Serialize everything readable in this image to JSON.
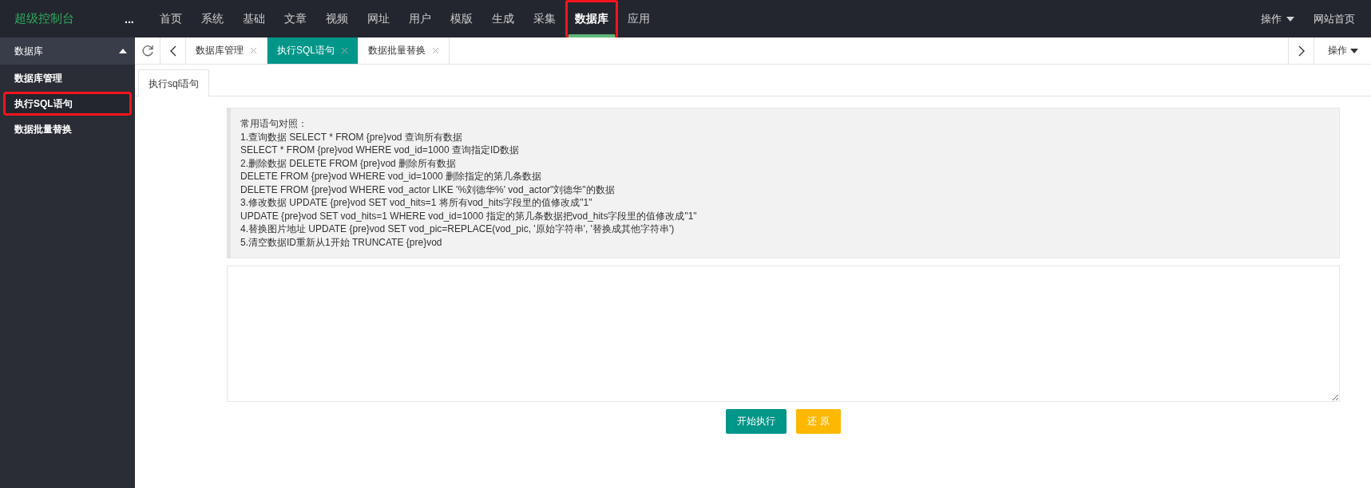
{
  "brand": "超级控制台",
  "nav_more": "...",
  "nav": [
    {
      "label": "首页",
      "selected": false,
      "highlighted": false
    },
    {
      "label": "系统",
      "selected": false,
      "highlighted": false
    },
    {
      "label": "基础",
      "selected": false,
      "highlighted": false
    },
    {
      "label": "文章",
      "selected": false,
      "highlighted": false
    },
    {
      "label": "视频",
      "selected": false,
      "highlighted": false
    },
    {
      "label": "网址",
      "selected": false,
      "highlighted": false
    },
    {
      "label": "用户",
      "selected": false,
      "highlighted": false
    },
    {
      "label": "模版",
      "selected": false,
      "highlighted": false
    },
    {
      "label": "生成",
      "selected": false,
      "highlighted": false
    },
    {
      "label": "采集",
      "selected": false,
      "highlighted": false
    },
    {
      "label": "数据库",
      "selected": true,
      "highlighted": true
    },
    {
      "label": "应用",
      "selected": false,
      "highlighted": false
    }
  ],
  "top_right": {
    "menu": "操作",
    "link": "网站首页"
  },
  "sidebar": {
    "title": "数据库",
    "expanded": true,
    "items": [
      {
        "label": "数据库管理",
        "selected": false,
        "highlighted": false
      },
      {
        "label": "执行SQL语句",
        "selected": true,
        "highlighted": true
      },
      {
        "label": "数据批量替换",
        "selected": false,
        "highlighted": false
      }
    ]
  },
  "tabs": [
    {
      "label": "数据库管理",
      "selected": false
    },
    {
      "label": "执行SQL语句",
      "selected": true
    },
    {
      "label": "数据批量替换",
      "selected": false
    }
  ],
  "tabs_menu": "操作",
  "sub_tabs": [
    {
      "label": "执行sql语句",
      "selected": true
    }
  ],
  "note_lines": [
    "常用语句对照：",
    "1.查询数据 SELECT * FROM {pre}vod 查询所有数据",
    "SELECT * FROM {pre}vod WHERE vod_id=1000 查询指定ID数据",
    "2.删除数据 DELETE FROM {pre}vod 删除所有数据",
    "DELETE FROM {pre}vod WHERE vod_id=1000 删除指定的第几条数据",
    "DELETE FROM {pre}vod WHERE vod_actor LIKE '%刘德华%' vod_actor\"刘德华\"的数据",
    "3.修改数据 UPDATE {pre}vod SET vod_hits=1 将所有vod_hits字段里的值修改成\"1\"",
    "UPDATE {pre}vod SET vod_hits=1 WHERE vod_id=1000 指定的第几条数据把vod_hits字段里的值修改成\"1\"",
    "4.替换图片地址 UPDATE {pre}vod SET vod_pic=REPLACE(vod_pic, '原始字符串', '替换成其他字符串')",
    "5.清空数据ID重新从1开始 TRUNCATE {pre}vod"
  ],
  "buttons": [
    {
      "label": "开始执行",
      "kind": "primary"
    },
    {
      "label": "还 原",
      "kind": "warning"
    }
  ]
}
